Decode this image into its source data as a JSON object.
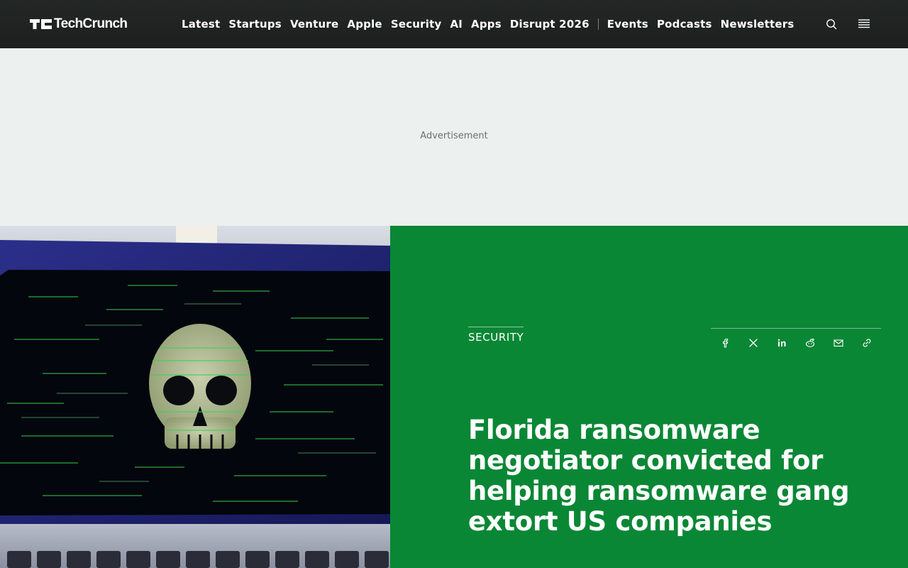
{
  "header": {
    "logo_text": "TechCrunch",
    "nav": [
      "Latest",
      "Startups",
      "Venture",
      "Apple",
      "Security",
      "AI",
      "Apps",
      "Disrupt 2026"
    ],
    "nav_secondary": [
      "Events",
      "Podcasts",
      "Newsletters"
    ],
    "icons": [
      "search-icon",
      "menu-icon"
    ]
  },
  "ad": {
    "label": "Advertisement"
  },
  "article": {
    "category": "SECURITY",
    "headline": "Florida ransomware negotiator convicted for helping ransomware gang extort US companies",
    "share_icons": [
      "facebook-icon",
      "x-icon",
      "linkedin-icon",
      "reddit-icon",
      "email-icon",
      "link-icon"
    ]
  },
  "colors": {
    "header_bg": "#1f2321",
    "ad_bg": "#ecf0ef",
    "accent_green": "#0a8735",
    "text_white": "#ffffff"
  }
}
